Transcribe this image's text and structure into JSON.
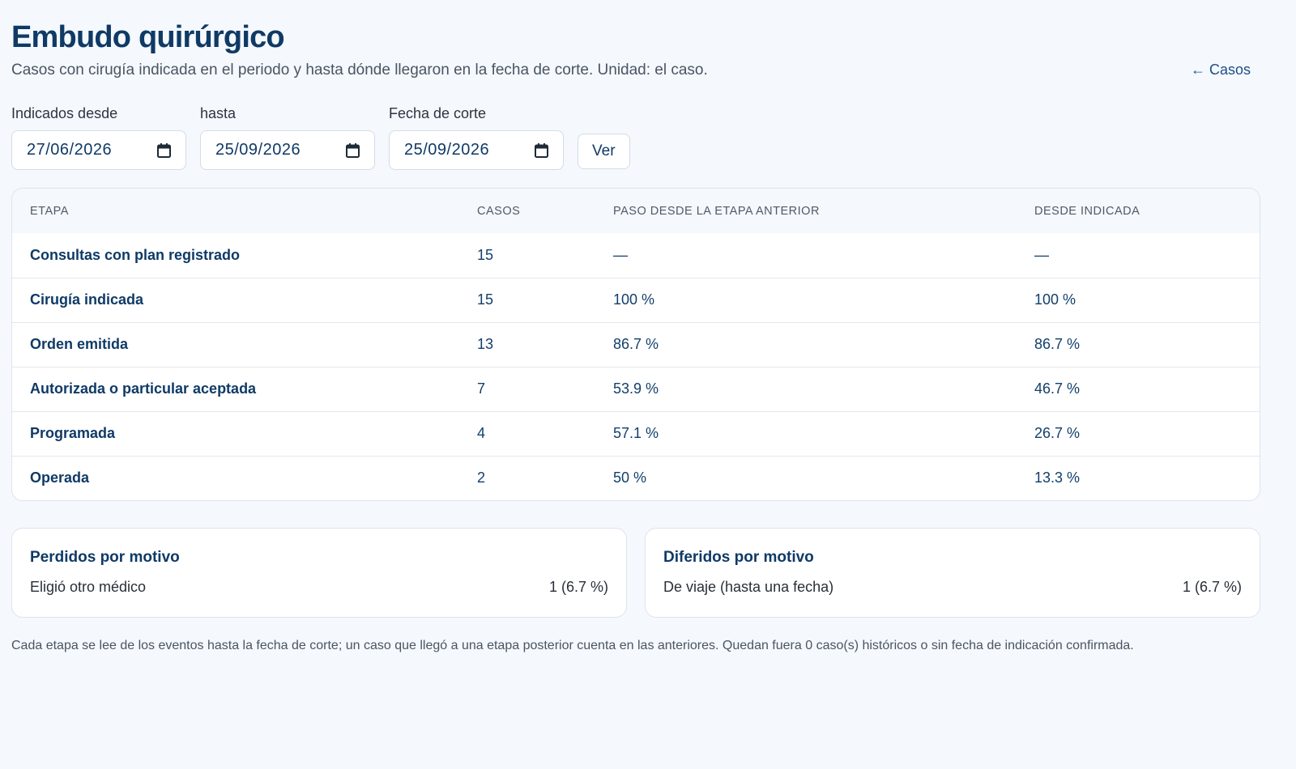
{
  "header": {
    "title": "Embudo quirúrgico",
    "subtitle": "Casos con cirugía indicada en el periodo y hasta dónde llegaron en la fecha de corte. Unidad: el caso.",
    "back_link": "← Casos"
  },
  "filters": {
    "from_label": "Indicados desde",
    "from_value": "27/06/2026",
    "to_label": "hasta",
    "to_value": "25/09/2026",
    "cutoff_label": "Fecha de corte",
    "cutoff_value": "25/09/2026",
    "submit_label": "Ver",
    "calendar_icon": "calendar-icon"
  },
  "funnel_table": {
    "columns": [
      "ETAPA",
      "CASOS",
      "PASO DESDE LA ETAPA ANTERIOR",
      "DESDE INDICADA"
    ],
    "rows": [
      {
        "stage": "Consultas con plan registrado",
        "cases": "15",
        "step": "—",
        "from_indicated": "—"
      },
      {
        "stage": "Cirugía indicada",
        "cases": "15",
        "step": "100 %",
        "from_indicated": "100 %"
      },
      {
        "stage": "Orden emitida",
        "cases": "13",
        "step": "86.7 %",
        "from_indicated": "86.7 %"
      },
      {
        "stage": "Autorizada o particular aceptada",
        "cases": "7",
        "step": "53.9 %",
        "from_indicated": "46.7 %"
      },
      {
        "stage": "Programada",
        "cases": "4",
        "step": "57.1 %",
        "from_indicated": "26.7 %"
      },
      {
        "stage": "Operada",
        "cases": "2",
        "step": "50 %",
        "from_indicated": "13.3 %"
      }
    ]
  },
  "lost_card": {
    "title": "Perdidos por motivo",
    "items": [
      {
        "reason": "Eligió otro médico",
        "value": "1 (6.7 %)"
      }
    ]
  },
  "deferred_card": {
    "title": "Diferidos por motivo",
    "items": [
      {
        "reason": "De viaje (hasta una fecha)",
        "value": "1 (6.7 %)"
      }
    ]
  },
  "footnote": "Cada etapa se lee de los eventos hasta la fecha de corte; un caso que llegó a una etapa posterior cuenta en las anteriores. Quedan fuera 0 caso(s) históricos o sin fecha de indicación confirmada.",
  "colors": {
    "background": "#f5f8fc",
    "title": "#0f3a66",
    "accent": "#1d4f86"
  }
}
